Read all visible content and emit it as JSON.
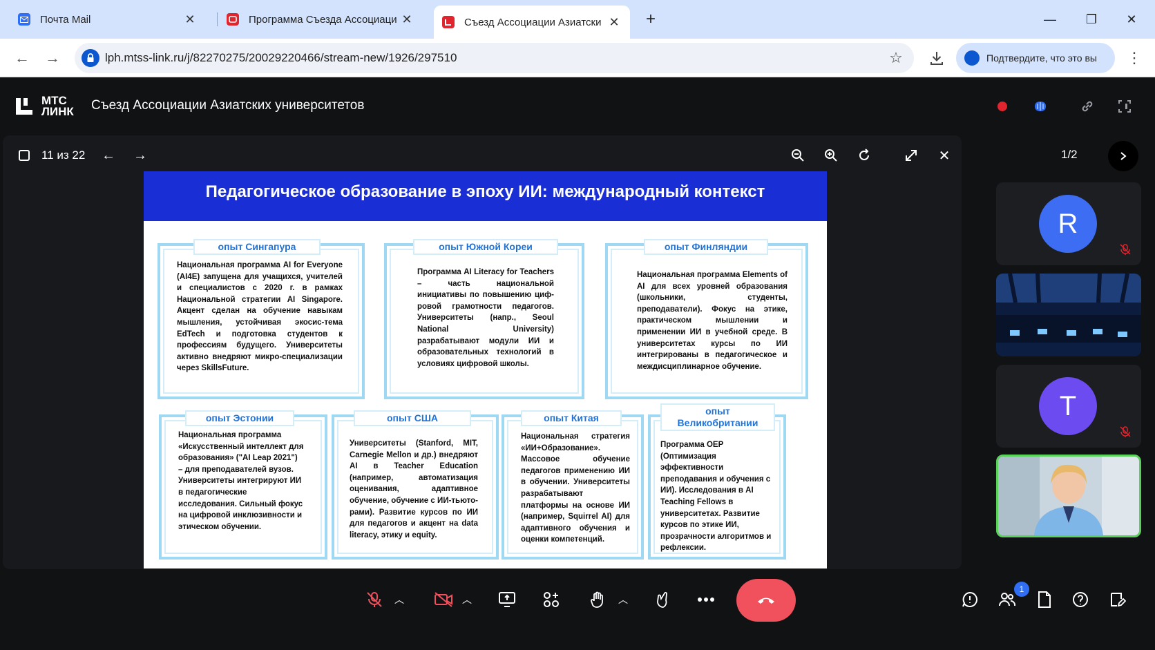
{
  "browser": {
    "tabs": [
      {
        "title": "Почта Mail",
        "favicon": "mail-icon"
      },
      {
        "title": "Программа Съезда Ассоциаци",
        "favicon": "mts-link-icon"
      },
      {
        "title": "Съезд Ассоциации Азиатски",
        "favicon": "mts-link-icon",
        "active": true
      }
    ],
    "url": "lph.mtss-link.ru/j/82270275/20029220466/stream-new/1926/297510",
    "verify_label": "Подтвердите, что это вы"
  },
  "app": {
    "logo_line1": "МТС",
    "logo_line2": "ЛИНК",
    "event_title": "Съезд Ассоциации Азиатских университетов",
    "recording_color": "#e0252f"
  },
  "presentation": {
    "page_indicator": "11 из 22",
    "slide": {
      "title": "Педагогическое образование в эпоху ИИ: международный контекст",
      "cards": [
        {
          "label": "опыт Сингапура",
          "text": "Национальная программа AI for Everyone (AI4E) запущена для учащихся, учителей и специалистов с 2020 г. в рамках Национальной стратегии AI Singapore. Акцент сделан на обучение навыкам мышления, устойчивая экосис-тема EdTech и подготовка студентов к профессиям будущего. Университеты активно внедряют микро-специализации через SkillsFuture."
        },
        {
          "label": "опыт Южной Кореи",
          "text": "Программа AI Literacy for Teachers – часть национальной инициативы по повышению циф-ровой грамотности педагогов. Университеты (напр., Seoul National University) разрабатывают модули ИИ и образовательных технологий в условиях цифровой школы."
        },
        {
          "label": "опыт Финляндии",
          "text": "Национальная программа Elements of AI для всех уровней образования (школьники, студенты, преподаватели). Фокус на этике, практическом мышлении и применении ИИ в учебной среде. В университетах курсы по ИИ интегрированы в педагогическое и междисциплинарное обучение."
        },
        {
          "label": "опыт Эстонии",
          "text": "Национальная программа «Искусственный интеллект для образования» (\"AI Leap 2021\") – для преподавателей вузов. Университеты интегрируют ИИ в педагогические исследования. Сильный фокус на цифровой инклюзивности и этическом обучении."
        },
        {
          "label": "опыт США",
          "text": "Университеты (Stanford, MIT, Carnegie Mellon и др.) внедряют AI в Teacher Education (например, автоматизация оценивания, адаптивное обучение, обучение с ИИ-тьюто-рами). Развитие курсов по ИИ для педагогов и акцент на data literacy, этику и equity."
        },
        {
          "label": "опыт Китая",
          "text": "Национальная стратегия «ИИ+Образование». Массовое обучение педагогов применению ИИ в обучении. Университеты разрабатывают платформы на основе ИИ (например, Squirrel AI) для адаптивного обучения и оценки компетенций."
        },
        {
          "label": "опыт Великобритании",
          "text": "Программа OEP (Оптимизация эффективности преподавания и обучения с ИИ). Исследования в AI Teaching Fellows в университетах. Развитие курсов по этике ИИ, прозрачности алгоритмов и рефлексии."
        }
      ]
    }
  },
  "participants": {
    "page": "1/2",
    "tiles": [
      {
        "type": "avatar",
        "letter": "R",
        "color": "#3d6df2",
        "muted": true
      },
      {
        "type": "video",
        "desc": "conference-hall"
      },
      {
        "type": "avatar",
        "letter": "T",
        "color": "#6c4cf0",
        "muted": true
      },
      {
        "type": "video",
        "desc": "speaker",
        "active_speaker": true
      }
    ]
  },
  "controls": {
    "participants_badge": "1",
    "hangup_color": "#f0515c",
    "accent": "#2f6ef5"
  }
}
